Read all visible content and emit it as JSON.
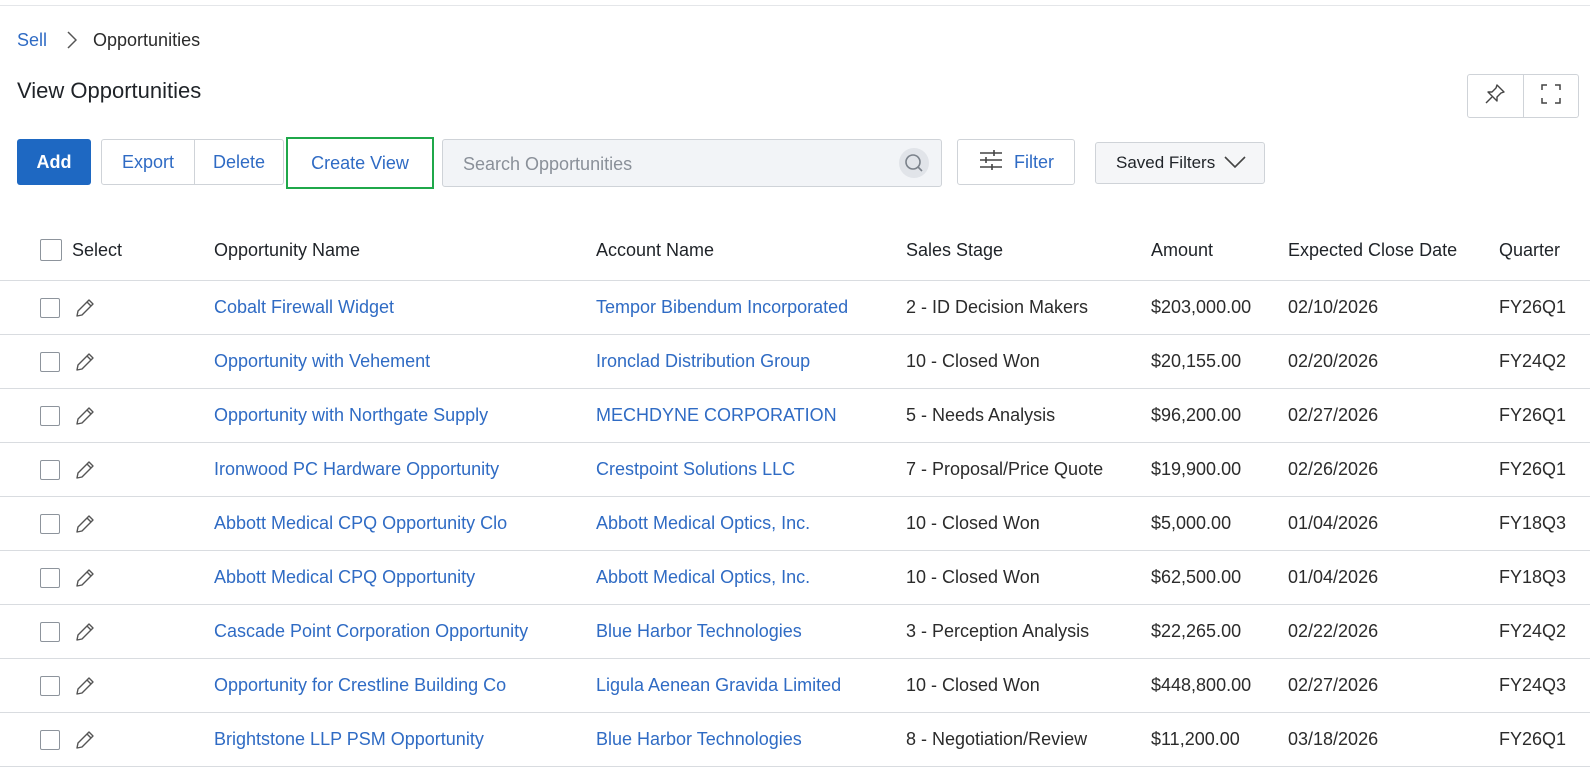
{
  "breadcrumb": {
    "parent": "Sell",
    "current": "Opportunities"
  },
  "page": {
    "title": "View Opportunities"
  },
  "header_actions": {
    "icons": [
      "pin-icon",
      "fullscreen-icon"
    ]
  },
  "toolbar": {
    "add_label": "Add",
    "export_label": "Export",
    "delete_label": "Delete",
    "create_view_label": "Create View",
    "search_placeholder": "Search Opportunities",
    "search_value": "",
    "filter_label": "Filter",
    "saved_filters_label": "Saved Filters"
  },
  "colors": {
    "primary": "#1e68c2",
    "link": "#2f6bc4",
    "highlight": "#1fa84a"
  },
  "table": {
    "headers": {
      "select": "Select",
      "name": "Opportunity Name",
      "account": "Account Name",
      "stage": "Sales Stage",
      "amount": "Amount",
      "close_date": "Expected Close Date",
      "quarter": "Quarter"
    },
    "rows": [
      {
        "name": "Cobalt Firewall Widget",
        "account": "Tempor Bibendum Incorporated",
        "stage": "2 - ID Decision Makers",
        "amount": "$203,000.00",
        "close_date": "02/10/2026",
        "quarter": "FY26Q1"
      },
      {
        "name": "Opportunity with Vehement",
        "account": "Ironclad Distribution Group",
        "stage": "10 - Closed Won",
        "amount": "$20,155.00",
        "close_date": "02/20/2026",
        "quarter": "FY24Q2"
      },
      {
        "name": "Opportunity with Northgate Supply",
        "account": "MECHDYNE CORPORATION",
        "stage": "5 - Needs Analysis",
        "amount": "$96,200.00",
        "close_date": "02/27/2026",
        "quarter": "FY26Q1"
      },
      {
        "name": "Ironwood PC Hardware Opportunity",
        "account": "Crestpoint Solutions LLC",
        "stage": "7 - Proposal/Price Quote",
        "amount": "$19,900.00",
        "close_date": "02/26/2026",
        "quarter": "FY26Q1"
      },
      {
        "name": "Abbott Medical CPQ Opportunity Clo",
        "account": "Abbott Medical Optics, Inc.",
        "stage": "10 - Closed Won",
        "amount": "$5,000.00",
        "close_date": "01/04/2026",
        "quarter": "FY18Q3"
      },
      {
        "name": "Abbott Medical CPQ Opportunity",
        "account": "Abbott Medical Optics, Inc.",
        "stage": "10 - Closed Won",
        "amount": "$62,500.00",
        "close_date": "01/04/2026",
        "quarter": "FY18Q3"
      },
      {
        "name": "Cascade Point Corporation Opportunity",
        "account": "Blue Harbor Technologies",
        "stage": "3 - Perception Analysis",
        "amount": "$22,265.00",
        "close_date": "02/22/2026",
        "quarter": "FY24Q2"
      },
      {
        "name": "Opportunity for Crestline Building Co",
        "account": "Ligula Aenean Gravida Limited",
        "stage": "10 - Closed Won",
        "amount": "$448,800.00",
        "close_date": "02/27/2026",
        "quarter": "FY24Q3"
      },
      {
        "name": "Brightstone LLP PSM Opportunity",
        "account": "Blue Harbor Technologies",
        "stage": "8 - Negotiation/Review",
        "amount": "$11,200.00",
        "close_date": "03/18/2026",
        "quarter": "FY26Q1"
      }
    ]
  }
}
